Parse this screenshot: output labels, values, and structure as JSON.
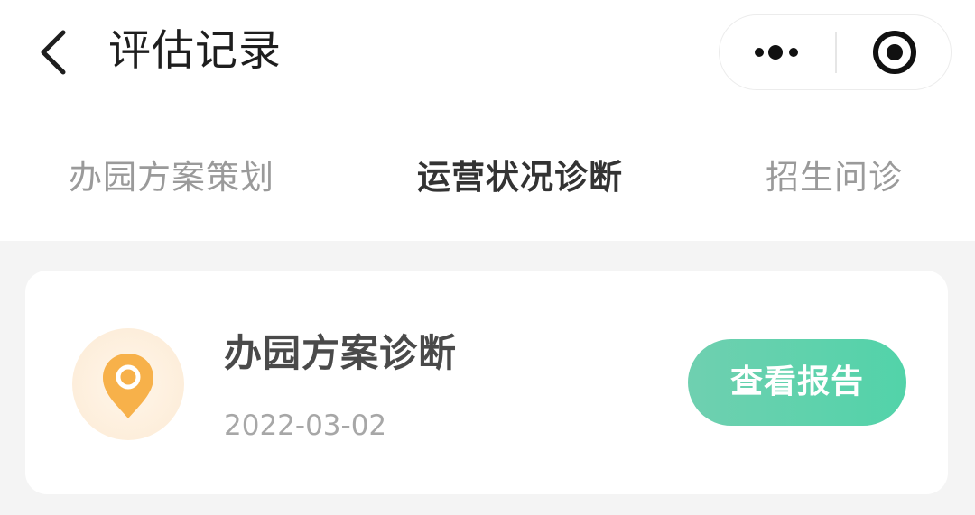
{
  "header": {
    "title": "评估记录",
    "back_icon": "back-arrow-icon",
    "more_icon": "more-dots-icon",
    "close_icon": "target-circle-icon"
  },
  "tabs": [
    {
      "label": "办园方案策划",
      "active": false
    },
    {
      "label": "运营状况诊断",
      "active": true
    },
    {
      "label": "招生问诊",
      "active": false
    }
  ],
  "records": [
    {
      "title": "办园方案诊断",
      "date": "2022-03-02",
      "icon": "location-pin-icon",
      "action_label": "查看报告"
    }
  ],
  "colors": {
    "accent": "#52d3a9",
    "icon_orange": "#f7b14a",
    "active_tab": "#333333",
    "inactive_tab": "#9a9a9a"
  }
}
